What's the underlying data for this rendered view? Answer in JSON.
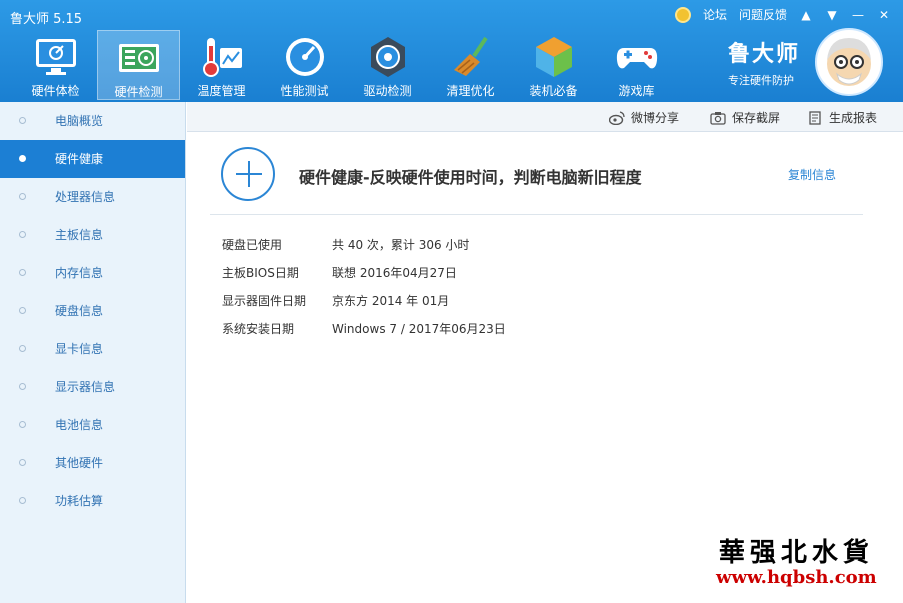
{
  "app": {
    "title": "鲁大师 5.15"
  },
  "window_links": {
    "forum": "论坛",
    "feedback": "问题反馈"
  },
  "nav": {
    "items": [
      {
        "label": "硬件体检",
        "icon": "monitor-icon"
      },
      {
        "label": "硬件检测",
        "icon": "circuit-board-icon",
        "active": true
      },
      {
        "label": "温度管理",
        "icon": "thermometer-icon"
      },
      {
        "label": "性能测试",
        "icon": "speedometer-icon"
      },
      {
        "label": "驱动检测",
        "icon": "gear-icon"
      },
      {
        "label": "清理优化",
        "icon": "broom-icon"
      },
      {
        "label": "装机必备",
        "icon": "cube-icon"
      },
      {
        "label": "游戏库",
        "icon": "gamepad-icon"
      }
    ]
  },
  "brand": {
    "name": "鲁大师",
    "slogan": "专注硬件防护"
  },
  "sidebar": {
    "items": [
      {
        "label": "电脑概览"
      },
      {
        "label": "硬件健康",
        "active": true
      },
      {
        "label": "处理器信息"
      },
      {
        "label": "主板信息"
      },
      {
        "label": "内存信息"
      },
      {
        "label": "硬盘信息"
      },
      {
        "label": "显卡信息"
      },
      {
        "label": "显示器信息"
      },
      {
        "label": "电池信息"
      },
      {
        "label": "其他硬件"
      },
      {
        "label": "功耗估算"
      }
    ]
  },
  "toolbar": {
    "share": "微博分享",
    "screenshot": "保存截屏",
    "report": "生成报表"
  },
  "content": {
    "headline": "硬件健康-反映硬件使用时间，判断电脑新旧程度",
    "copy_label": "复制信息",
    "rows": [
      {
        "key": "硬盘已使用",
        "value": "共 40 次，累计 306 小时"
      },
      {
        "key": "主板BIOS日期",
        "value": "联想 2016年04月27日"
      },
      {
        "key": "显示器固件日期",
        "value": "京东方 2014 年 01月"
      },
      {
        "key": "系统安装日期",
        "value": "Windows 7 / 2017年06月23日"
      }
    ]
  },
  "watermark": {
    "title": "華强北水貨",
    "url": "www.hqbsh.com"
  },
  "colors": {
    "title_bar": "#1a7fd1",
    "accent": "#1c7fd4",
    "sidebar_bg": "#e9f3fb",
    "link": "#2b86d5",
    "watermark_url": "#cc0000"
  }
}
